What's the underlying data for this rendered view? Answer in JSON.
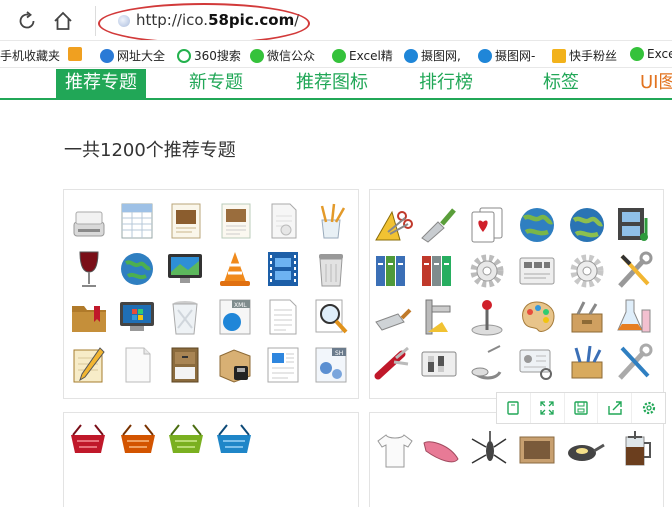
{
  "browser": {
    "url_prefix": "http://ico.",
    "url_domain": "58pic.com",
    "url_suffix": "/"
  },
  "bookmarks": [
    {
      "label": "手机收藏夹",
      "icon": "none"
    },
    {
      "label": "",
      "icon": "bookmark-icon"
    },
    {
      "label": "网址大全",
      "icon": "nav-site-icon"
    },
    {
      "label": "360搜索",
      "icon": "search-icon"
    },
    {
      "label": "微信公众",
      "icon": "wechat-icon"
    },
    {
      "label": "Excel精",
      "icon": "wechat-icon"
    },
    {
      "label": "摄图网,",
      "icon": "photo-icon"
    },
    {
      "label": "摄图网-",
      "icon": "photo-icon"
    },
    {
      "label": "快手粉丝",
      "icon": "folder-icon"
    },
    {
      "label": "Exce",
      "icon": "wechat-icon"
    }
  ],
  "site_nav": {
    "tabs": [
      {
        "label": "推荐专题",
        "active": true
      },
      {
        "label": "新专题",
        "active": false
      },
      {
        "label": "推荐图标",
        "active": false
      },
      {
        "label": "排行榜",
        "active": false
      },
      {
        "label": "标签",
        "active": false
      },
      {
        "label": "UI图",
        "active": false
      }
    ]
  },
  "main": {
    "heading": "一共1200个推荐专题"
  },
  "card_tools": [
    "copy-icon",
    "expand-icon",
    "save-icon",
    "share-icon",
    "settings-icon"
  ],
  "colors": {
    "brand_green": "#21a757",
    "ui_orange": "#e2731f",
    "annotation_red": "#d23a3a"
  }
}
